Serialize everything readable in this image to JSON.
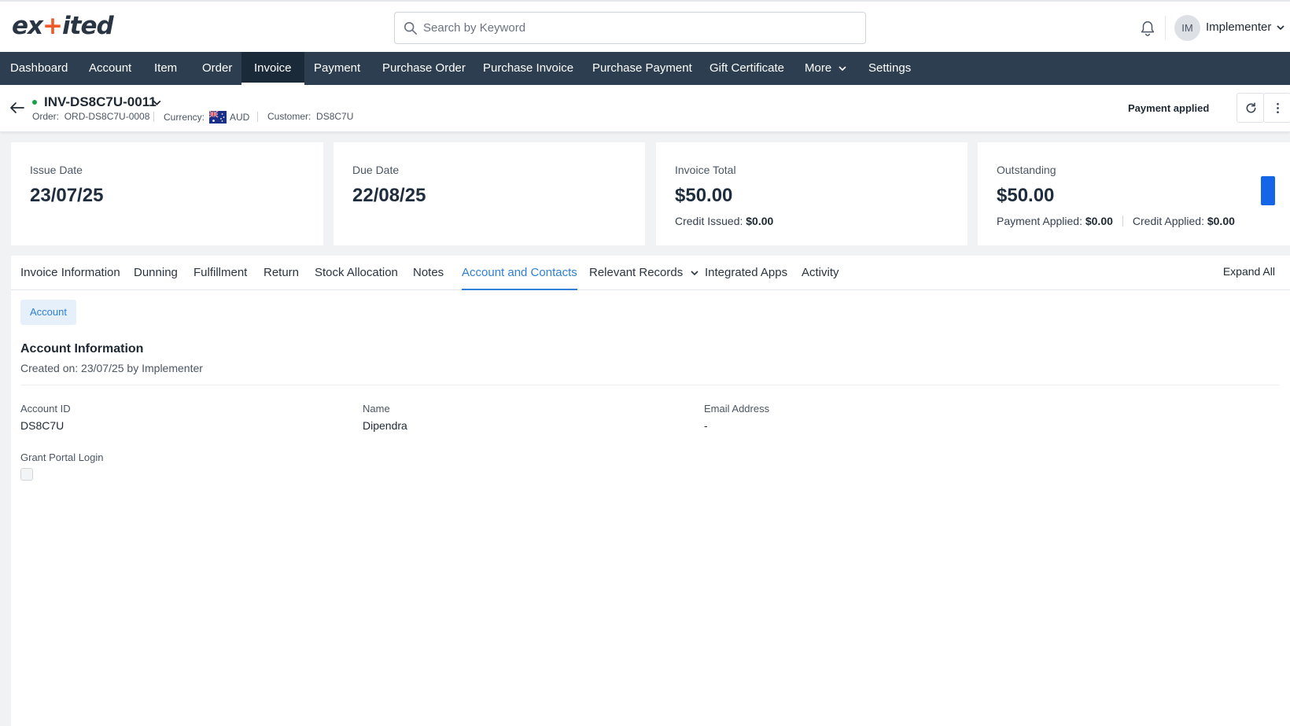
{
  "brand": {
    "logo_pre": "ex",
    "logo_accent": "+",
    "logo_post": "ited"
  },
  "search": {
    "placeholder": "Search by Keyword"
  },
  "user": {
    "initials": "IM",
    "name": "Implementer"
  },
  "nav": {
    "items": [
      "Dashboard",
      "Account",
      "Item",
      "Order",
      "Invoice",
      "Payment",
      "Purchase Order",
      "Purchase Invoice",
      "Purchase Payment",
      "Gift Certificate",
      "More",
      "Settings"
    ],
    "active": "Invoice"
  },
  "record": {
    "title": "INV-DS8C7U-0011",
    "order_label": "Order:",
    "order_value": "ORD-DS8C7U-0008",
    "currency_label": "Currency:",
    "currency_value": "AUD",
    "customer_label": "Customer:",
    "customer_value": "DS8C7U",
    "status": "Payment applied"
  },
  "cards": {
    "issue": {
      "label": "Issue Date",
      "value": "23/07/25"
    },
    "due": {
      "label": "Due Date",
      "value": "22/08/25"
    },
    "total": {
      "label": "Invoice Total",
      "value": "$50.00",
      "credit_label": "Credit Issued:",
      "credit_value": "$0.00"
    },
    "outstanding": {
      "label": "Outstanding",
      "value": "$50.00",
      "payment_label": "Payment Applied:",
      "payment_value": "$0.00",
      "credit_label": "Credit Applied:",
      "credit_value": "$0.00"
    }
  },
  "tabs": {
    "items": [
      "Invoice Information",
      "Dunning",
      "Fulfillment",
      "Return",
      "Stock Allocation",
      "Notes",
      "Account and Contacts",
      "Relevant Records",
      "Integrated Apps",
      "Activity"
    ],
    "active": "Account and Contacts",
    "expand_all": "Expand All"
  },
  "subtab": "Account",
  "section": {
    "title": "Account Information",
    "created": "Created on: 23/07/25 by Implementer"
  },
  "fields": {
    "account_id": {
      "label": "Account ID",
      "value": "DS8C7U"
    },
    "name": {
      "label": "Name",
      "value": "Dipendra"
    },
    "email": {
      "label": "Email Address",
      "value": "-"
    },
    "portal": {
      "label": "Grant Portal Login",
      "checked": false
    }
  },
  "colors": {
    "nav_bg": "#2c3e50",
    "accent_blue": "#2f7fd6",
    "logo_accent": "#f05a28",
    "status_green": "#16a34a",
    "indicator_blue": "#1565e8"
  }
}
